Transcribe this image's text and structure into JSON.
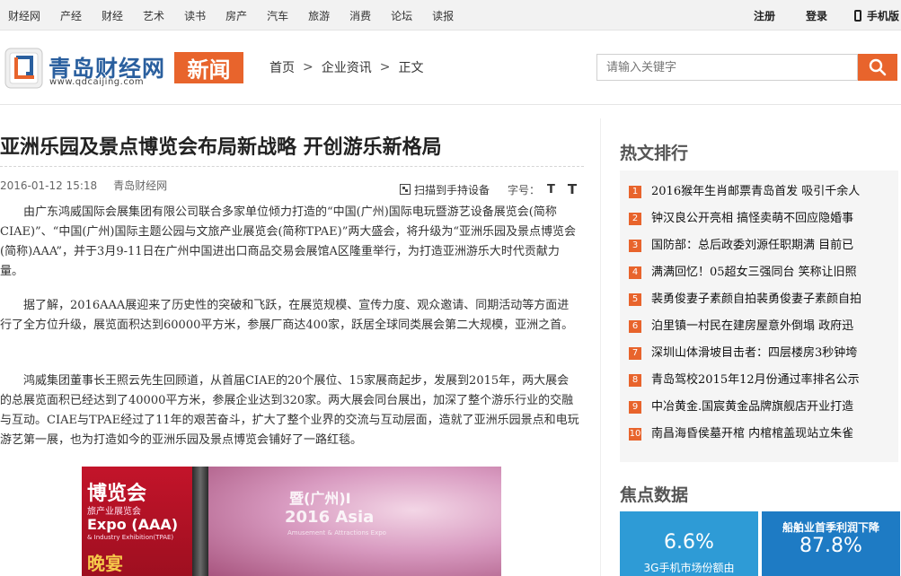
{
  "topnav": {
    "items": [
      "财经网",
      "产经",
      "财经",
      "艺术",
      "读书",
      "房产",
      "汽车",
      "旅游",
      "消费",
      "论坛",
      "读报"
    ],
    "register": "注册",
    "login": "登录",
    "mobile": "手机版"
  },
  "header": {
    "logo_title": "青岛财经网",
    "logo_url": "www.qdcaijing.com",
    "section_tag": "新闻",
    "breadcrumb": [
      "首页",
      "企业资讯",
      "正文"
    ],
    "search_placeholder": "请输入关键字"
  },
  "article": {
    "title": "亚洲乐园及景点博览会布局新战略 开创游乐新格局",
    "date": "2016-01-12 15:18",
    "source": "青岛财经网",
    "scan_label": "扫描到手持设备",
    "font_size_label": "字号：",
    "font_small": "T",
    "font_large": "T",
    "paragraphs": [
      "由广东鸿威国际会展集团有限公司联合多家单位倾力打造的“中国(广州)国际电玩暨游艺设备展览会(简称CIAE)”、“中国(广州)国际主题公园与文旅产业展览会(简称TPAE)”两大盛会，将升级为“亚洲乐园及景点博览会(简称)AAA”，并于3月9-11日在广州中国进出口商品交易会展馆A区隆重举行，为打造亚洲游乐大时代贡献力量。",
      "据了解，2016AAA展迎来了历史性的突破和飞跃，在展览规模、宣传力度、观众邀请、同期活动等方面进行了全方位升级，展览面积达到60000平方米，参展厂商达400家，跃居全球同类展会第二大规模，亚洲之首。",
      "鸿威集团董事长王照云先生回顾道，从首届CIAE的20个展位、15家展商起步，发展到2015年，两大展会的总展览面积已经达到了40000平方米，参展企业达到320家。两大展会同台展出，加深了整个游乐行业的交融与互动。CIAE与TPAE经过了11年的艰苦奋斗，扩大了整个业界的交流与互动层面，造就了亚洲乐园景点和电玩游艺第一展，也为打造如今的亚洲乐园及景点博览会铺好了一路红毯。"
    ],
    "photo": {
      "left_lines": [
        "博览会",
        "旅产业展览会",
        "Expo (AAA)",
        "& Industry Exhibition(TPAE)",
        "晚宴"
      ],
      "right_lines": [
        "暨(广州)I",
        "2016 Asia",
        "Amusement & Attractions Expo"
      ]
    }
  },
  "sidebar": {
    "hot_title": "热文排行",
    "hot_items": [
      {
        "rank": "1",
        "text": "2016猴年生肖邮票青岛首发 吸引千余人"
      },
      {
        "rank": "2",
        "text": "钟汉良公开亮相 搞怪卖萌不回应隐婚事"
      },
      {
        "rank": "3",
        "text": "国防部：总后政委刘源任职期满 目前已"
      },
      {
        "rank": "4",
        "text": "满满回忆！05超女三强同台 笑称让旧照"
      },
      {
        "rank": "5",
        "text": "裴勇俊妻子素颜自拍裴勇俊妻子素颜自拍"
      },
      {
        "rank": "6",
        "text": "泊里镇一村民在建房屋意外倒塌 政府迅"
      },
      {
        "rank": "7",
        "text": "深圳山体滑坡目击者：四层楼房3秒钟垮"
      },
      {
        "rank": "8",
        "text": "青岛驾校2015年12月份通过率排名公示"
      },
      {
        "rank": "9",
        "text": "中冶黄金.国宸黄金品牌旗舰店开业打造"
      },
      {
        "rank": "10",
        "text": "南昌海昏侯墓开棺 内棺棺盖现站立朱雀"
      }
    ],
    "focus_title": "焦点数据",
    "focus_cards": [
      {
        "value": "6.6%",
        "label": "3G手机市场份额由"
      },
      {
        "label": "船舶业首季利润下降",
        "value": "87.8%"
      }
    ]
  },
  "colors": {
    "accent": "#e8642c",
    "brand_blue": "#2a5f9e",
    "card_blue": "#2e9bd6",
    "card_blue_dark": "#1e7bc4"
  }
}
